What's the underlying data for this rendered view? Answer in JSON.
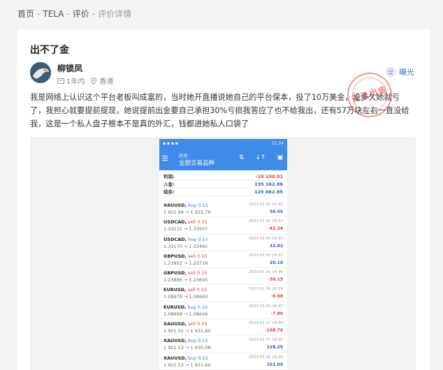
{
  "breadcrumb": {
    "home": "首页",
    "brand": "TELA",
    "review": "评价",
    "current": "评价详情",
    "sep": "-"
  },
  "post": {
    "title": "出不了金",
    "author": "柳锁凤",
    "duration": "1年内",
    "location": "香港",
    "badge_label": "曝光",
    "stamp_text": "无法出金",
    "content": "我是网络上认识这个平台老板叫成富的，当时她开直播说她自己的平台保本，投了10万美金，没多久她就亏了，我担心就要提前提现，她说提前出金要自己承担30%亏损我答应了也不给我出，还有57万块左右一直没给我，这是一个私人盘子根本不是真的外汇，钱都进她私人口袋了"
  },
  "phone": {
    "status_time": "11:24",
    "status_left": "▪ ▪ ▪ ▪",
    "header_sub": "历史",
    "header_title": "全部交易品种",
    "summary": [
      {
        "label": "利润:",
        "value": "-10 100.01",
        "neg": true
      },
      {
        "label": "入金:",
        "value": "135 162.86",
        "neg": false
      },
      {
        "label": "结余:",
        "value": "125 062.85",
        "neg": false
      }
    ],
    "trades": [
      {
        "symbol": "XAUUSD,",
        "side": "buy",
        "lot": "0.15",
        "prices": "1 921.99 → 1 925.76",
        "time": "2023.01.31 01:41",
        "pl": "56.55",
        "neg": false
      },
      {
        "symbol": "USDCAD,",
        "side": "sell",
        "lot": "0.15",
        "prices": "1.33131 → 1.33507",
        "time": "2023.01.30 16:33",
        "pl": "-42.24",
        "neg": true
      },
      {
        "symbol": "USDCAD,",
        "side": "buy",
        "lot": "0.15",
        "prices": "1.33170 → 1.33462",
        "time": "2023.01.30 16:33",
        "pl": "32.82",
        "neg": false
      },
      {
        "symbol": "GBPUSD,",
        "side": "sell",
        "lot": "0.15",
        "prices": "1.23852 → 1.23718",
        "time": "2023.01.30 16:33",
        "pl": "20.10",
        "neg": false
      },
      {
        "symbol": "GBPUSD,",
        "side": "sell",
        "lot": "0.15",
        "prices": "1.23896 → 1.23695",
        "time": "2023.01.30 16:34",
        "pl": "-30.15",
        "neg": true
      },
      {
        "symbol": "EURUSD,",
        "side": "sell",
        "lot": "0.15",
        "prices": "1.08679 → 1.08683",
        "time": "2023.01.30 16:34",
        "pl": "-0.60",
        "neg": true
      },
      {
        "symbol": "EURUSD,",
        "side": "buy",
        "lot": "0.15",
        "prices": "1.08698 → 1.08646",
        "time": "2023.01.30 16:33",
        "pl": "-7.80",
        "neg": true
      },
      {
        "symbol": "XAUUSD,",
        "side": "sell",
        "lot": "0.15",
        "prices": "1 921.02 → 1 931.60",
        "time": "2023.01.27 19:34",
        "pl": "-158.70",
        "neg": true
      },
      {
        "symbol": "XAUUSD,",
        "side": "buy",
        "lot": "0.15",
        "prices": "1 921.53 → 1 930.08",
        "time": "2023.01.27 18:45",
        "pl": "128.25",
        "neg": false
      },
      {
        "symbol": "XAUUSD,",
        "side": "buy",
        "lot": "0.15",
        "prices": "1 921.53 → 1 931.60",
        "time": "2023.01.26 16:26",
        "pl": "151.05",
        "neg": false
      }
    ]
  }
}
